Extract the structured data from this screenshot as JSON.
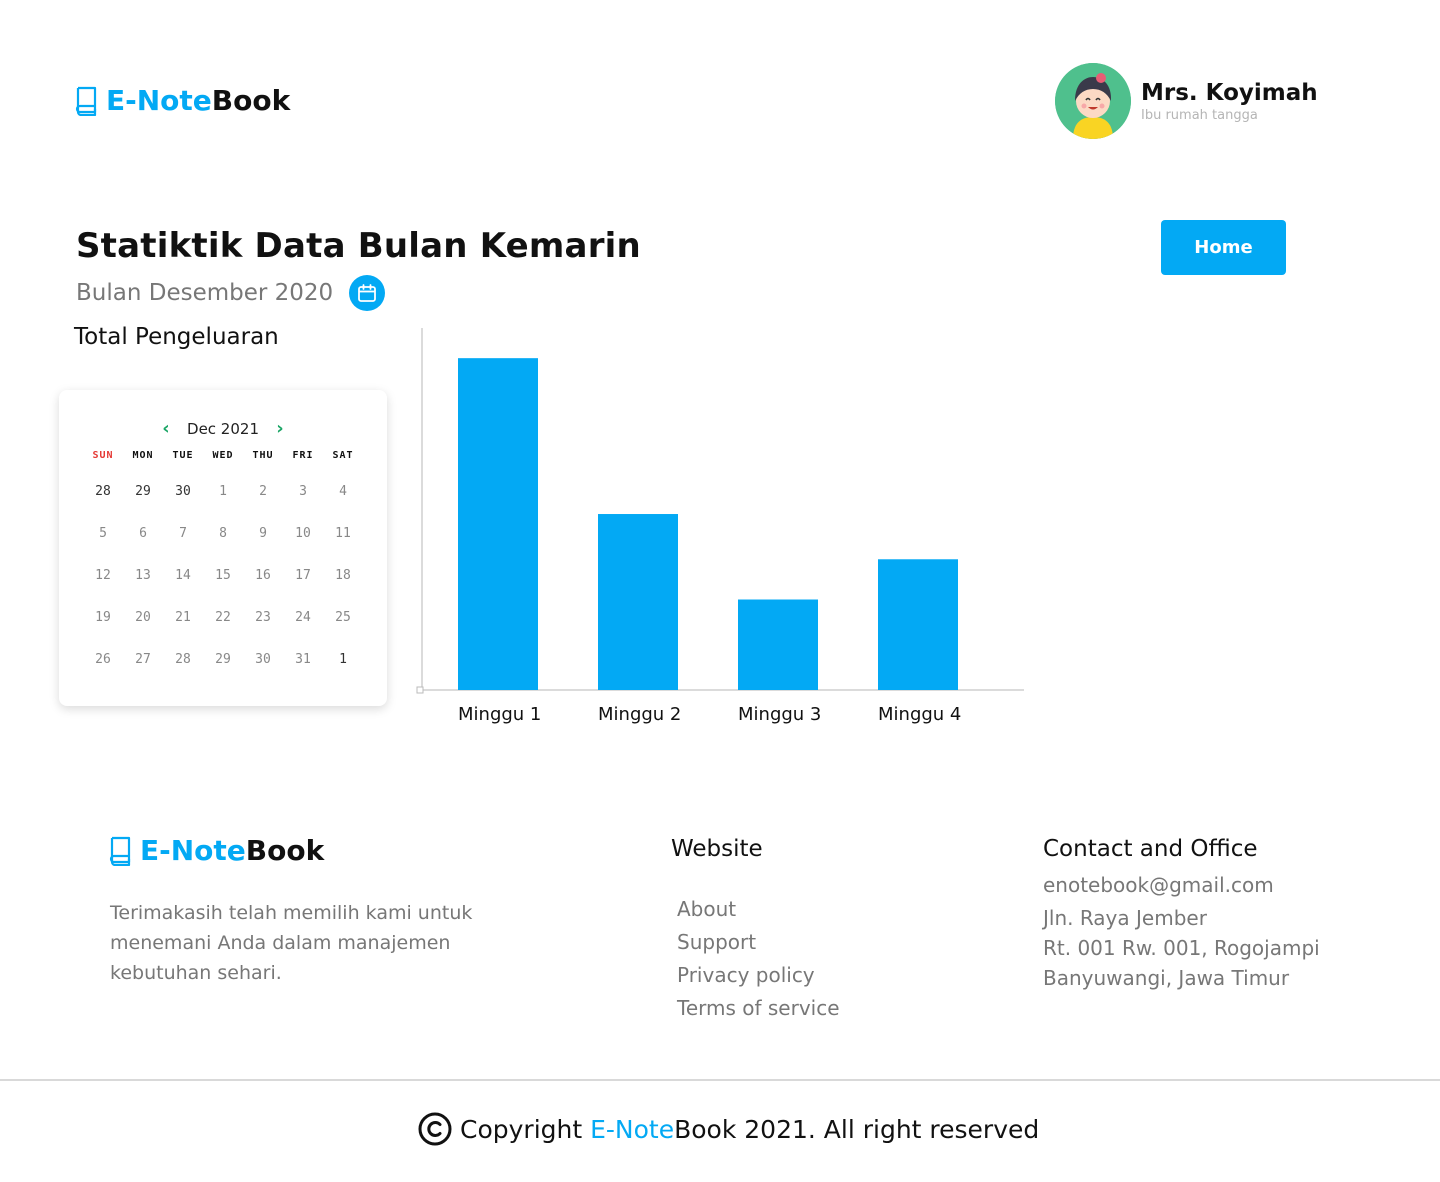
{
  "header": {
    "logo_accent": "E-Note",
    "logo_dark": "Book",
    "user_name": "Mrs. Koyimah",
    "user_role": "Ibu rumah tangga"
  },
  "main": {
    "title": "Statiktik Data Bulan Kemarin",
    "month": "Bulan Desember 2020",
    "home_label": "Home",
    "section_label": "Total Pengeluaran"
  },
  "calendar": {
    "month_label": "Dec 2021",
    "weekdays": [
      "SUN",
      "MON",
      "TUE",
      "WED",
      "THU",
      "FRI",
      "SAT"
    ],
    "days": [
      [
        "28",
        "29",
        "30",
        "1",
        "2",
        "3",
        "4"
      ],
      [
        "5",
        "6",
        "7",
        "8",
        "9",
        "10",
        "11"
      ],
      [
        "12",
        "13",
        "14",
        "15",
        "16",
        "17",
        "18"
      ],
      [
        "19",
        "20",
        "21",
        "22",
        "23",
        "24",
        "25"
      ],
      [
        "26",
        "27",
        "28",
        "29",
        "30",
        "31",
        "1"
      ]
    ]
  },
  "chart_data": {
    "type": "bar",
    "categories": [
      "Minggu 1",
      "Minggu 2",
      "Minggu 3",
      "Minggu 4"
    ],
    "values": [
      330,
      175,
      90,
      130
    ],
    "ylim": [
      0,
      360
    ],
    "color": "#03A9F4",
    "grid": false
  },
  "footer": {
    "logo_accent": "E-Note",
    "logo_dark": "Book",
    "description": "Terimakasih telah memilih kami untuk menemani Anda dalam manajemen kebutuhan sehari.",
    "website_heading": "Website",
    "links": [
      "About",
      "Support",
      "Privacy policy",
      "Terms of service"
    ],
    "contact_heading": "Contact and Office",
    "email": "enotebook@gmail.com",
    "address": [
      "Jln. Raya Jember",
      "Rt. 001 Rw. 001, Rogojampi",
      "Banyuwangi, Jawa Timur"
    ]
  },
  "copyright": {
    "prefix": "Copyright",
    "brand_accent": "E-Note",
    "brand_rest": "Book 2021. All right reserved"
  },
  "colors": {
    "accent": "#03A9F4",
    "calendar_nav": "#1aa565",
    "sunday": "#e53935"
  }
}
